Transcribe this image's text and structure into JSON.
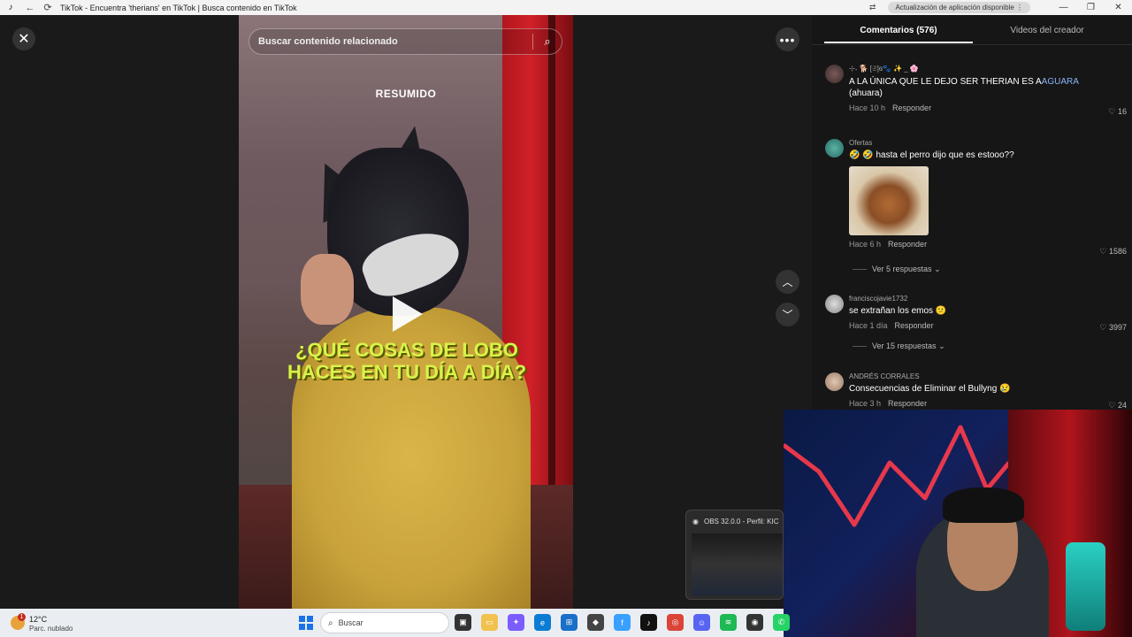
{
  "window": {
    "title": "TikTok - Encuentra 'therians' en TikTok | Busca contenido en TikTok",
    "update_label": "Actualización de aplicación disponible",
    "more_glyph": "⋮",
    "back_glyph": "←",
    "reload_glyph": "⟳",
    "minimize_glyph": "—",
    "maximize_glyph": "❐",
    "close_glyph": "✕"
  },
  "player": {
    "search_placeholder": "Buscar contenido relacionado",
    "overlay_label": "RESUMIDO",
    "headline": "¿QUÉ COSAS DE LOBO HACES EN TU DÍA A DÍA?",
    "close_glyph": "✕",
    "more_glyph": "•••",
    "up_glyph": "︿",
    "down_glyph": "﹀"
  },
  "panel": {
    "tabs": [
      {
        "label": "Comentarios (576)",
        "active": true
      },
      {
        "label": "Videos del creador",
        "active": false
      }
    ],
    "comments": [
      {
        "user": "⊹˖ 🐕 [𝔖]ɞ🐾 ✨ _ 🌸",
        "text_before": "A LA ÚNICA QUE LE DEJO SER THERIAN ES A",
        "text_highlight": "AGUARA",
        "text_after": " (ahuara)",
        "time": "Hace 10 h",
        "reply": "Responder",
        "likes": "16"
      },
      {
        "user": "Ofertas",
        "text": "🤣 🤣 hasta el perro dijo que es estooo??",
        "time": "Hace 6 h",
        "reply": "Responder",
        "likes": "1586",
        "view_replies": "Ver 5 respuestas"
      },
      {
        "user": "franciscojavie1732",
        "text": "se extrañan los emos 😕",
        "time": "Hace 1 día",
        "reply": "Responder",
        "likes": "3997",
        "view_replies": "Ver 15 respuestas"
      },
      {
        "user": "ANDRÉS CORRALES",
        "text": "Consecuencias de Eliminar el Bullyng 😢",
        "time": "Hace 3 h",
        "reply": "Responder",
        "likes": "24"
      }
    ]
  },
  "obs": {
    "title": "OBS 32.0.0 - Perfil: KIC"
  },
  "taskbar": {
    "temp": "12°C",
    "weather_desc": "Parc. nublado",
    "notification_count": "1",
    "search_label": "Buscar"
  },
  "colors": {
    "headline": "#d8f34a",
    "highlight_link": "#8ab4f8",
    "windows_blue": "#1a73e8"
  }
}
